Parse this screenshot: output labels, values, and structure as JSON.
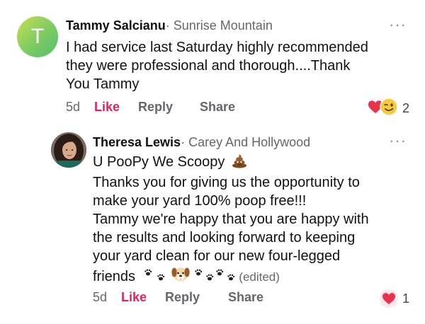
{
  "comments": [
    {
      "author": "Tammy Salcianu",
      "separator": "·",
      "location": "Sunrise Mountain",
      "avatar_letter": "T",
      "lines": [
        "I had service last Saturday highly recommended",
        "they were professional and thorough....Thank",
        "You Tammy"
      ],
      "time": "5d",
      "like_label": "Like",
      "reply_label": "Reply",
      "share_label": "Share",
      "reaction_count": "2",
      "reaction_icons": [
        "heart-icon",
        "wink-face-icon"
      ]
    },
    {
      "author": "Theresa Lewis",
      "separator": "·",
      "location": "Carey And Hollywood",
      "lines": [
        "U PooPy We Scoopy",
        "Thanks you for giving us the opportunity to",
        "make your yard 100% poop free!!!",
        "Tammy we're happy that you are happy with",
        "the results and looking forward to keeping",
        "your yard clean for our new four-legged",
        "friends"
      ],
      "edited_label": "(edited)",
      "time": "5d",
      "like_label": "Like",
      "reply_label": "Reply",
      "share_label": "Share",
      "reaction_count": "1",
      "reaction_icons": [
        "heart-icon"
      ]
    }
  ],
  "more_label": "···",
  "colors": {
    "like_active": "#e0245e",
    "secondary_text": "#65676b",
    "heart": "#e8334a"
  }
}
